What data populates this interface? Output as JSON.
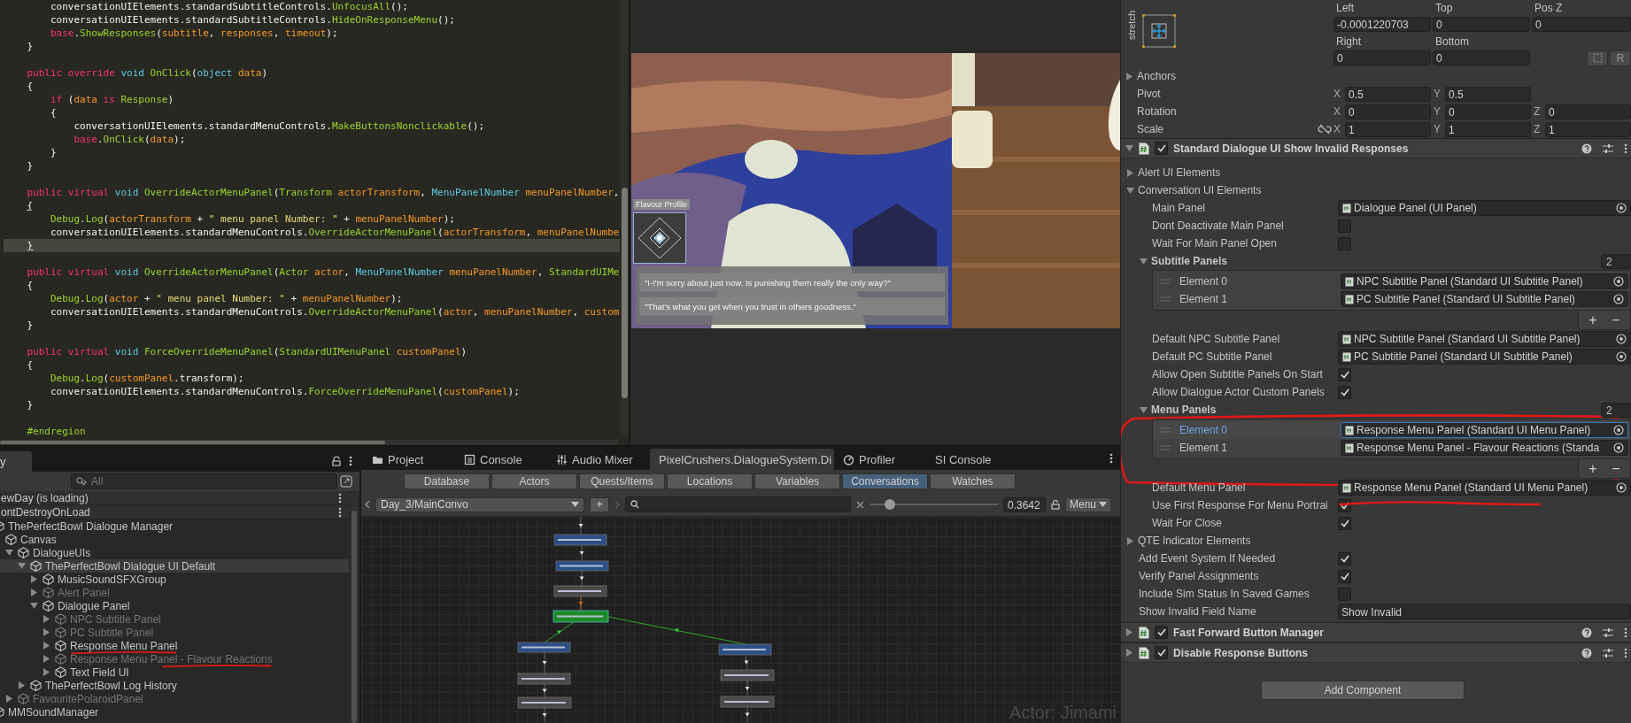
{
  "code_editor": {
    "blocks": [
      {
        "lines": [
          {
            "segments": [
              {
                "kind": "plain",
                "text": "        conversationUIElements.standardSubtitleControls."
              },
              {
                "kind": "method",
                "text": "UnfocusAll"
              },
              {
                "kind": "plain",
                "text": "();"
              }
            ],
            "current": false
          },
          {
            "segments": [
              {
                "kind": "plain",
                "text": "        conversationUIElements.standardSubtitleControls."
              },
              {
                "kind": "method",
                "text": "HideOnResponseMenu"
              },
              {
                "kind": "plain",
                "text": "();"
              }
            ],
            "current": false
          },
          {
            "segments": [
              {
                "kind": "keyword",
                "text": "        base"
              },
              {
                "kind": "plain",
                "text": "."
              },
              {
                "kind": "method",
                "text": "ShowResponses"
              },
              {
                "kind": "plain",
                "text": "("
              },
              {
                "kind": "variable",
                "text": "subtitle"
              },
              {
                "kind": "plain",
                "text": ", "
              },
              {
                "kind": "variable",
                "text": "responses"
              },
              {
                "kind": "plain",
                "text": ", "
              },
              {
                "kind": "variable",
                "text": "timeout"
              },
              {
                "kind": "plain",
                "text": ");"
              }
            ],
            "current": false
          },
          {
            "segments": [
              {
                "kind": "plain",
                "text": "    }"
              }
            ],
            "current": false
          }
        ]
      },
      {
        "lines": [
          {
            "segments": [
              {
                "kind": "keyword",
                "text": "    public override "
              },
              {
                "kind": "type",
                "text": "void "
              },
              {
                "kind": "method",
                "text": "OnClick"
              },
              {
                "kind": "plain",
                "text": "("
              },
              {
                "kind": "type",
                "text": "object "
              },
              {
                "kind": "variable",
                "text": "data"
              },
              {
                "kind": "plain",
                "text": ")"
              }
            ],
            "current": false
          },
          {
            "segments": [
              {
                "kind": "plain",
                "text": "    {"
              }
            ],
            "current": false
          },
          {
            "segments": [
              {
                "kind": "keyword",
                "text": "        if "
              },
              {
                "kind": "plain",
                "text": "("
              },
              {
                "kind": "variable",
                "text": "data "
              },
              {
                "kind": "keyword",
                "text": "is "
              },
              {
                "kind": "method",
                "text": "Response"
              },
              {
                "kind": "plain",
                "text": ")"
              }
            ],
            "current": false
          },
          {
            "segments": [
              {
                "kind": "plain",
                "text": "        {"
              }
            ],
            "current": false
          },
          {
            "segments": [
              {
                "kind": "plain",
                "text": "            conversationUIElements.standardMenuControls."
              },
              {
                "kind": "method",
                "text": "MakeButtonsNonclickable"
              },
              {
                "kind": "plain",
                "text": "();"
              }
            ],
            "current": false
          },
          {
            "segments": [
              {
                "kind": "keyword",
                "text": "            base"
              },
              {
                "kind": "plain",
                "text": "."
              },
              {
                "kind": "method",
                "text": "OnClick"
              },
              {
                "kind": "plain",
                "text": "("
              },
              {
                "kind": "variable",
                "text": "data"
              },
              {
                "kind": "plain",
                "text": ");"
              }
            ],
            "current": false
          },
          {
            "segments": [
              {
                "kind": "plain",
                "text": "        }"
              }
            ],
            "current": false
          },
          {
            "segments": [
              {
                "kind": "plain",
                "text": "    }"
              }
            ],
            "current": false
          }
        ]
      },
      {
        "lines": [
          {
            "segments": [
              {
                "kind": "keyword",
                "text": "    public virtual "
              },
              {
                "kind": "type",
                "text": "void "
              },
              {
                "kind": "method",
                "text": "OverrideActorMenuPanel"
              },
              {
                "kind": "plain",
                "text": "("
              },
              {
                "kind": "method",
                "text": "Transform "
              },
              {
                "kind": "variable",
                "text": "actorTransform"
              },
              {
                "kind": "plain",
                "text": ", "
              },
              {
                "kind": "type",
                "text": "MenuPanelNumber "
              },
              {
                "kind": "variable",
                "text": "menuPanelNumber"
              },
              {
                "kind": "plain",
                "text": ","
              }
            ],
            "current": false
          },
          {
            "segments": [
              {
                "kind": "bracket",
                "text": "    {"
              }
            ],
            "current": false
          },
          {
            "segments": [
              {
                "kind": "method",
                "text": "        Debug"
              },
              {
                "kind": "plain",
                "text": "."
              },
              {
                "kind": "method",
                "text": "Log"
              },
              {
                "kind": "plain",
                "text": "("
              },
              {
                "kind": "variable",
                "text": "actorTransform"
              },
              {
                "kind": "plain",
                "text": " + "
              },
              {
                "kind": "string",
                "text": "\" menu panel Number: \""
              },
              {
                "kind": "plain",
                "text": " + "
              },
              {
                "kind": "variable",
                "text": "menuPanelNumber"
              },
              {
                "kind": "plain",
                "text": ");"
              }
            ],
            "current": false
          },
          {
            "segments": [
              {
                "kind": "plain",
                "text": "        conversationUIElements.standardMenuControls."
              },
              {
                "kind": "method",
                "text": "OverrideActorMenuPanel"
              },
              {
                "kind": "plain",
                "text": "("
              },
              {
                "kind": "variable",
                "text": "actorTransform"
              },
              {
                "kind": "plain",
                "text": ", "
              },
              {
                "kind": "variable",
                "text": "menuPanelNumbe"
              }
            ],
            "current": false
          },
          {
            "segments": [
              {
                "kind": "bracket",
                "text": "    }"
              }
            ],
            "current": true
          }
        ]
      },
      {
        "lines": [
          {
            "segments": [
              {
                "kind": "keyword",
                "text": "    public virtual "
              },
              {
                "kind": "type",
                "text": "void "
              },
              {
                "kind": "method",
                "text": "OverrideActorMenuPanel"
              },
              {
                "kind": "plain",
                "text": "("
              },
              {
                "kind": "method",
                "text": "Actor "
              },
              {
                "kind": "variable",
                "text": "actor"
              },
              {
                "kind": "plain",
                "text": ", "
              },
              {
                "kind": "type",
                "text": "MenuPanelNumber "
              },
              {
                "kind": "variable",
                "text": "menuPanelNumber"
              },
              {
                "kind": "plain",
                "text": ", "
              },
              {
                "kind": "method",
                "text": "StandardUIMe"
              }
            ],
            "current": false
          },
          {
            "segments": [
              {
                "kind": "plain",
                "text": "    {"
              }
            ],
            "current": false
          },
          {
            "segments": [
              {
                "kind": "method",
                "text": "        Debug"
              },
              {
                "kind": "plain",
                "text": "."
              },
              {
                "kind": "method",
                "text": "Log"
              },
              {
                "kind": "plain",
                "text": "("
              },
              {
                "kind": "variable",
                "text": "actor"
              },
              {
                "kind": "plain",
                "text": " + "
              },
              {
                "kind": "string",
                "text": "\" menu panel Number: \""
              },
              {
                "kind": "plain",
                "text": " + "
              },
              {
                "kind": "variable",
                "text": "menuPanelNumber"
              },
              {
                "kind": "plain",
                "text": ");"
              }
            ],
            "current": false
          },
          {
            "segments": [
              {
                "kind": "plain",
                "text": "        conversationUIElements.standardMenuControls."
              },
              {
                "kind": "method",
                "text": "OverrideActorMenuPanel"
              },
              {
                "kind": "plain",
                "text": "("
              },
              {
                "kind": "variable",
                "text": "actor"
              },
              {
                "kind": "plain",
                "text": ", "
              },
              {
                "kind": "variable",
                "text": "menuPanelNumber"
              },
              {
                "kind": "plain",
                "text": ", "
              },
              {
                "kind": "variable",
                "text": "custom"
              }
            ],
            "current": false
          },
          {
            "segments": [
              {
                "kind": "plain",
                "text": "    }"
              }
            ],
            "current": false
          }
        ]
      },
      {
        "lines": [
          {
            "segments": [
              {
                "kind": "keyword",
                "text": "    public virtual "
              },
              {
                "kind": "type",
                "text": "void "
              },
              {
                "kind": "method",
                "text": "ForceOverrideMenuPanel"
              },
              {
                "kind": "plain",
                "text": "("
              },
              {
                "kind": "method",
                "text": "StandardUIMenuPanel "
              },
              {
                "kind": "variable",
                "text": "customPanel"
              },
              {
                "kind": "plain",
                "text": ")"
              }
            ],
            "current": false
          },
          {
            "segments": [
              {
                "kind": "plain",
                "text": "    {"
              }
            ],
            "current": false
          },
          {
            "segments": [
              {
                "kind": "method",
                "text": "        Debug"
              },
              {
                "kind": "plain",
                "text": "."
              },
              {
                "kind": "method",
                "text": "Log"
              },
              {
                "kind": "plain",
                "text": "("
              },
              {
                "kind": "variable",
                "text": "customPanel"
              },
              {
                "kind": "plain",
                "text": ".transform);"
              }
            ],
            "current": false
          },
          {
            "segments": [
              {
                "kind": "plain",
                "text": "        conversationUIElements.standardMenuControls."
              },
              {
                "kind": "method",
                "text": "ForceOverrideMenuPanel"
              },
              {
                "kind": "plain",
                "text": "("
              },
              {
                "kind": "variable",
                "text": "customPanel"
              },
              {
                "kind": "plain",
                "text": ");"
              }
            ],
            "current": false
          },
          {
            "segments": [
              {
                "kind": "plain",
                "text": "    }"
              }
            ],
            "current": false
          }
        ]
      },
      {
        "lines": [
          {
            "segments": [
              {
                "kind": "directive",
                "text": "    #endregion"
              }
            ],
            "current": false
          }
        ]
      }
    ]
  },
  "game_view": {
    "flavour_label": "Flavour Profile",
    "responses": [
      {
        "text": "\"I-I'm sorry about just now. Is punishing them really the only way?\""
      },
      {
        "text": "\"That's what you get when you trust in others goodness.\""
      }
    ]
  },
  "hierarchy": {
    "tab": "y",
    "search": {
      "placeholder": "All"
    },
    "items": [
      {
        "label": "ewDay (is loading)",
        "kind": "scene"
      },
      {
        "label": "ontDestroyOnLoad",
        "kind": "scene"
      },
      {
        "label": "ThePerfectBowl Dialogue Manager",
        "kind": "object",
        "active": true,
        "selected": false,
        "underlined": false,
        "children": [
          {
            "label": "Canvas",
            "kind": "object",
            "active": true,
            "selected": false,
            "underlined": false,
            "children": [
              {
                "label": "DialogueUIs",
                "kind": "object",
                "active": true,
                "selected": false,
                "underlined": false,
                "expanded": true,
                "children": [
                  {
                    "label": "ThePerfectBowl Dialogue UI Default",
                    "kind": "object",
                    "active": true,
                    "selected": true,
                    "underlined": false,
                    "expanded": true,
                    "children": [
                      {
                        "label": "MusicSoundSFXGroup",
                        "kind": "object",
                        "active": true,
                        "selected": false,
                        "underlined": false,
                        "expanded": false
                      },
                      {
                        "label": "Alert Panel",
                        "kind": "object",
                        "active": false,
                        "selected": false,
                        "underlined": false,
                        "expanded": false
                      },
                      {
                        "label": "Dialogue Panel",
                        "kind": "object",
                        "active": true,
                        "selected": false,
                        "underlined": false,
                        "expanded": true,
                        "children": [
                          {
                            "label": "NPC Subtitle Panel",
                            "kind": "object",
                            "active": false,
                            "selected": false,
                            "underlined": false,
                            "expanded": false
                          },
                          {
                            "label": "PC Subtitle Panel",
                            "kind": "object",
                            "active": false,
                            "selected": false,
                            "underlined": false,
                            "expanded": false
                          },
                          {
                            "label": "Response Menu Panel",
                            "kind": "object",
                            "active": true,
                            "selected": false,
                            "underlined": true,
                            "expanded": false
                          },
                          {
                            "label": "Response Menu Panel - Flavour Reactions",
                            "kind": "object",
                            "active": false,
                            "selected": false,
                            "underlined": true,
                            "expanded": false
                          },
                          {
                            "label": "Text Field UI",
                            "kind": "object",
                            "active": true,
                            "selected": false,
                            "underlined": false,
                            "expanded": false
                          }
                        ]
                      }
                    ]
                  },
                  {
                    "label": "ThePerfectBowl Log History",
                    "kind": "object",
                    "active": true,
                    "selected": false,
                    "underlined": false,
                    "expanded": false
                  }
                ]
              },
              {
                "label": "FavouritePolaroidPanel",
                "kind": "object",
                "active": false,
                "selected": false,
                "underlined": false,
                "expanded": false
              }
            ]
          }
        ]
      },
      {
        "label": "MMSoundManager",
        "kind": "object",
        "active": true,
        "selected": false,
        "underlined": false
      }
    ]
  },
  "bottom_tabs": [
    {
      "label": "Project",
      "kind": "folder",
      "selected": false
    },
    {
      "label": "Console",
      "kind": "console",
      "selected": false
    },
    {
      "label": "Audio Mixer",
      "kind": "mixer",
      "selected": false
    },
    {
      "label": "PixelCrushers.DialogueSystem.Di",
      "kind": "plain",
      "selected": true
    },
    {
      "label": "Profiler",
      "kind": "profiler",
      "selected": false
    },
    {
      "label": "SI Console",
      "kind": "plain",
      "selected": false
    }
  ],
  "dialogue_editor": {
    "tabs": [
      {
        "label": "Database",
        "selected": false
      },
      {
        "label": "Actors",
        "selected": false
      },
      {
        "label": "Quests/Items",
        "selected": false
      },
      {
        "label": "Locations",
        "selected": false
      },
      {
        "label": "Variables",
        "selected": false
      },
      {
        "label": "Conversations",
        "selected": true
      },
      {
        "label": "Watches",
        "selected": false
      }
    ],
    "conversation": "Day_3/MainConvo",
    "add_button": "+",
    "zoom": {
      "level": 0.16,
      "value": "0.3642"
    },
    "menu": "Menu",
    "actor_label": "Actor: Jimami"
  },
  "inspector": {
    "rect_transform": {
      "anchor_preset": "stretch",
      "offset_labels": [
        "Left",
        "Top",
        "Pos Z"
      ],
      "offsets": [
        "-0.0001220703",
        "0",
        "0"
      ],
      "offset_labels_2": [
        "Right",
        "Bottom"
      ],
      "offsets_2": [
        "0",
        "0"
      ],
      "raw_button": "R",
      "anchors": {
        "label": "Anchors",
        "expanded": false
      },
      "vectors": [
        {
          "label": "Pivot",
          "linked": false,
          "axes": [
            {
              "axis": "X",
              "value": "0.5"
            },
            {
              "axis": "Y",
              "value": "0.5"
            }
          ]
        },
        {
          "label": "Rotation",
          "linked": false,
          "axes": [
            {
              "axis": "X",
              "value": "0"
            },
            {
              "axis": "Y",
              "value": "0"
            },
            {
              "axis": "Z",
              "value": "0"
            }
          ]
        },
        {
          "label": "Scale",
          "linked": true,
          "axes": [
            {
              "axis": "X",
              "value": "1"
            },
            {
              "axis": "Y",
              "value": "1"
            },
            {
              "axis": "Z",
              "value": "1"
            }
          ]
        }
      ]
    },
    "components": [
      {
        "title": "Standard Dialogue UI Show Invalid Responses",
        "enabled": true,
        "expanded": true,
        "properties": [
          {
            "kind": "foldout",
            "label": "Alert UI Elements",
            "expanded": false
          },
          {
            "kind": "foldout",
            "label": "Conversation UI Elements",
            "expanded": true,
            "children": [
              {
                "kind": "object",
                "label": "Main Panel",
                "value": "Dialogue Panel (UI Panel)"
              },
              {
                "kind": "toggle",
                "label": "Dont Deactivate Main Panel",
                "checked": false,
                "underlined": false
              },
              {
                "kind": "toggle",
                "label": "Wait For Main Panel Open",
                "checked": false,
                "underlined": false
              },
              {
                "kind": "list",
                "label": "Subtitle Panels",
                "count": "2",
                "expanded": true,
                "circled": false,
                "elements": [
                  {
                    "label": "Element 0",
                    "value": "NPC Subtitle Panel (Standard UI Subtitle Panel)",
                    "selected": false
                  },
                  {
                    "label": "Element 1",
                    "value": "PC Subtitle Panel (Standard UI Subtitle Panel)",
                    "selected": false
                  }
                ],
                "add": "+",
                "remove": "−"
              },
              {
                "kind": "object",
                "label": "Default NPC Subtitle Panel",
                "value": "NPC Subtitle Panel (Standard UI Subtitle Panel)"
              },
              {
                "kind": "object",
                "label": "Default PC Subtitle Panel",
                "value": "PC Subtitle Panel (Standard UI Subtitle Panel)"
              },
              {
                "kind": "toggle",
                "label": "Allow Open Subtitle Panels On Start",
                "checked": true,
                "underlined": false
              },
              {
                "kind": "toggle",
                "label": "Allow Dialogue Actor Custom Panels",
                "checked": true,
                "underlined": false
              },
              {
                "kind": "list",
                "label": "Menu Panels",
                "count": "2",
                "expanded": true,
                "circled": true,
                "elements": [
                  {
                    "label": "Element 0",
                    "value": "Response Menu Panel (Standard UI Menu Panel)",
                    "selected": true
                  },
                  {
                    "label": "Element 1",
                    "value": "Response Menu Panel - Flavour Reactions (Standa",
                    "selected": false
                  }
                ],
                "add": "+",
                "remove": "−"
              },
              {
                "kind": "object",
                "label": "Default Menu Panel",
                "value": "Response Menu Panel (Standard UI Menu Panel)"
              },
              {
                "kind": "toggle",
                "label": "Use First Response For Menu Portrai",
                "checked": true,
                "underlined": true
              },
              {
                "kind": "toggle",
                "label": "Wait For Close",
                "checked": true,
                "underlined": false
              }
            ]
          },
          {
            "kind": "foldout",
            "label": "QTE Indicator Elements",
            "expanded": false
          },
          {
            "kind": "toggle",
            "label": "Add Event System If Needed",
            "checked": true,
            "underlined": false
          },
          {
            "kind": "toggle",
            "label": "Verify Panel Assignments",
            "checked": true,
            "underlined": false
          },
          {
            "kind": "toggle",
            "label": "Include Sim Status In Saved Games",
            "checked": false,
            "underlined": false
          },
          {
            "kind": "text",
            "label": "Show Invalid Field Name",
            "value": "Show Invalid"
          }
        ]
      },
      {
        "title": "Fast Forward Button Manager",
        "enabled": true,
        "expanded": false
      },
      {
        "title": "Disable Response Buttons",
        "enabled": true,
        "expanded": false
      }
    ],
    "add_component": "Add Component"
  }
}
